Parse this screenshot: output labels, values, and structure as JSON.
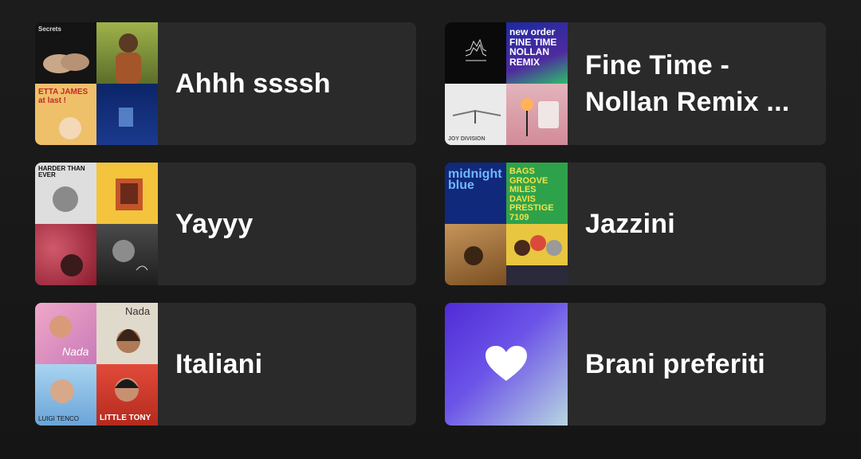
{
  "playlists": [
    {
      "title": "Ahhh ssssh",
      "covers": [
        {
          "name": "hands-cover",
          "bg": "#1b1b1b",
          "caption": "Secrets"
        },
        {
          "name": "portrait-green-cover",
          "bg": "#7a8e3a",
          "caption": ""
        },
        {
          "name": "etta-james-cover",
          "bg": "#e9b85a",
          "caption": "ETTA JAMES at last !"
        },
        {
          "name": "blue-night-cover",
          "bg": "#0e2a6b",
          "caption": ""
        }
      ]
    },
    {
      "title": "Fine Time - Nollan Remix ...",
      "covers": [
        {
          "name": "unknown-pleasures-cover",
          "bg": "#0a0a0a",
          "caption": ""
        },
        {
          "name": "new-order-cover",
          "bg": "#1f2a9a",
          "caption": "new order FINE TIME NOLLAN REMIX"
        },
        {
          "name": "closer-cover",
          "bg": "#e6e6e6",
          "caption": "JOY DIVISION"
        },
        {
          "name": "pink-lamp-cover",
          "bg": "#d9a0a8",
          "caption": ""
        }
      ]
    },
    {
      "title": "Yayyy",
      "covers": [
        {
          "name": "hardertheneverr-cover",
          "bg": "#e2e2e2",
          "caption": "HARDER THAN EVER"
        },
        {
          "name": "yellow-room-cover",
          "bg": "#f1c23a",
          "caption": ""
        },
        {
          "name": "red-marble-cover",
          "bg": "#9a2a3a",
          "caption": ""
        },
        {
          "name": "bw-portrait-cover",
          "bg": "#3a3a3a",
          "caption": ""
        }
      ]
    },
    {
      "title": "Jazzini",
      "covers": [
        {
          "name": "midnight-blue-cover",
          "bg": "#0f2f8c",
          "caption": "midnight blue"
        },
        {
          "name": "bags-groove-cover",
          "bg": "#2aa34a",
          "caption": "BAGS GROOVE MILES DAVIS PRESTIGE 7109"
        },
        {
          "name": "jazz-sepia-cover",
          "bg": "#b98a4a",
          "caption": ""
        },
        {
          "name": "jazz-trio-cover",
          "bg": "#e2c23a",
          "caption": ""
        }
      ]
    },
    {
      "title": "Italiani",
      "covers": [
        {
          "name": "nada-pink-cover",
          "bg": "#e7a0c0",
          "caption": "Nada"
        },
        {
          "name": "nada-portrait-cover",
          "bg": "#d9d2c2",
          "caption": "Nada"
        },
        {
          "name": "luigi-tenco-cover",
          "bg": "#9fc9e8",
          "caption": "LUIGI TENCO"
        },
        {
          "name": "little-tony-cover",
          "bg": "#d63a2a",
          "caption": "LITTLE TONY"
        }
      ]
    },
    {
      "title": "Brani preferiti",
      "liked": true
    }
  ]
}
